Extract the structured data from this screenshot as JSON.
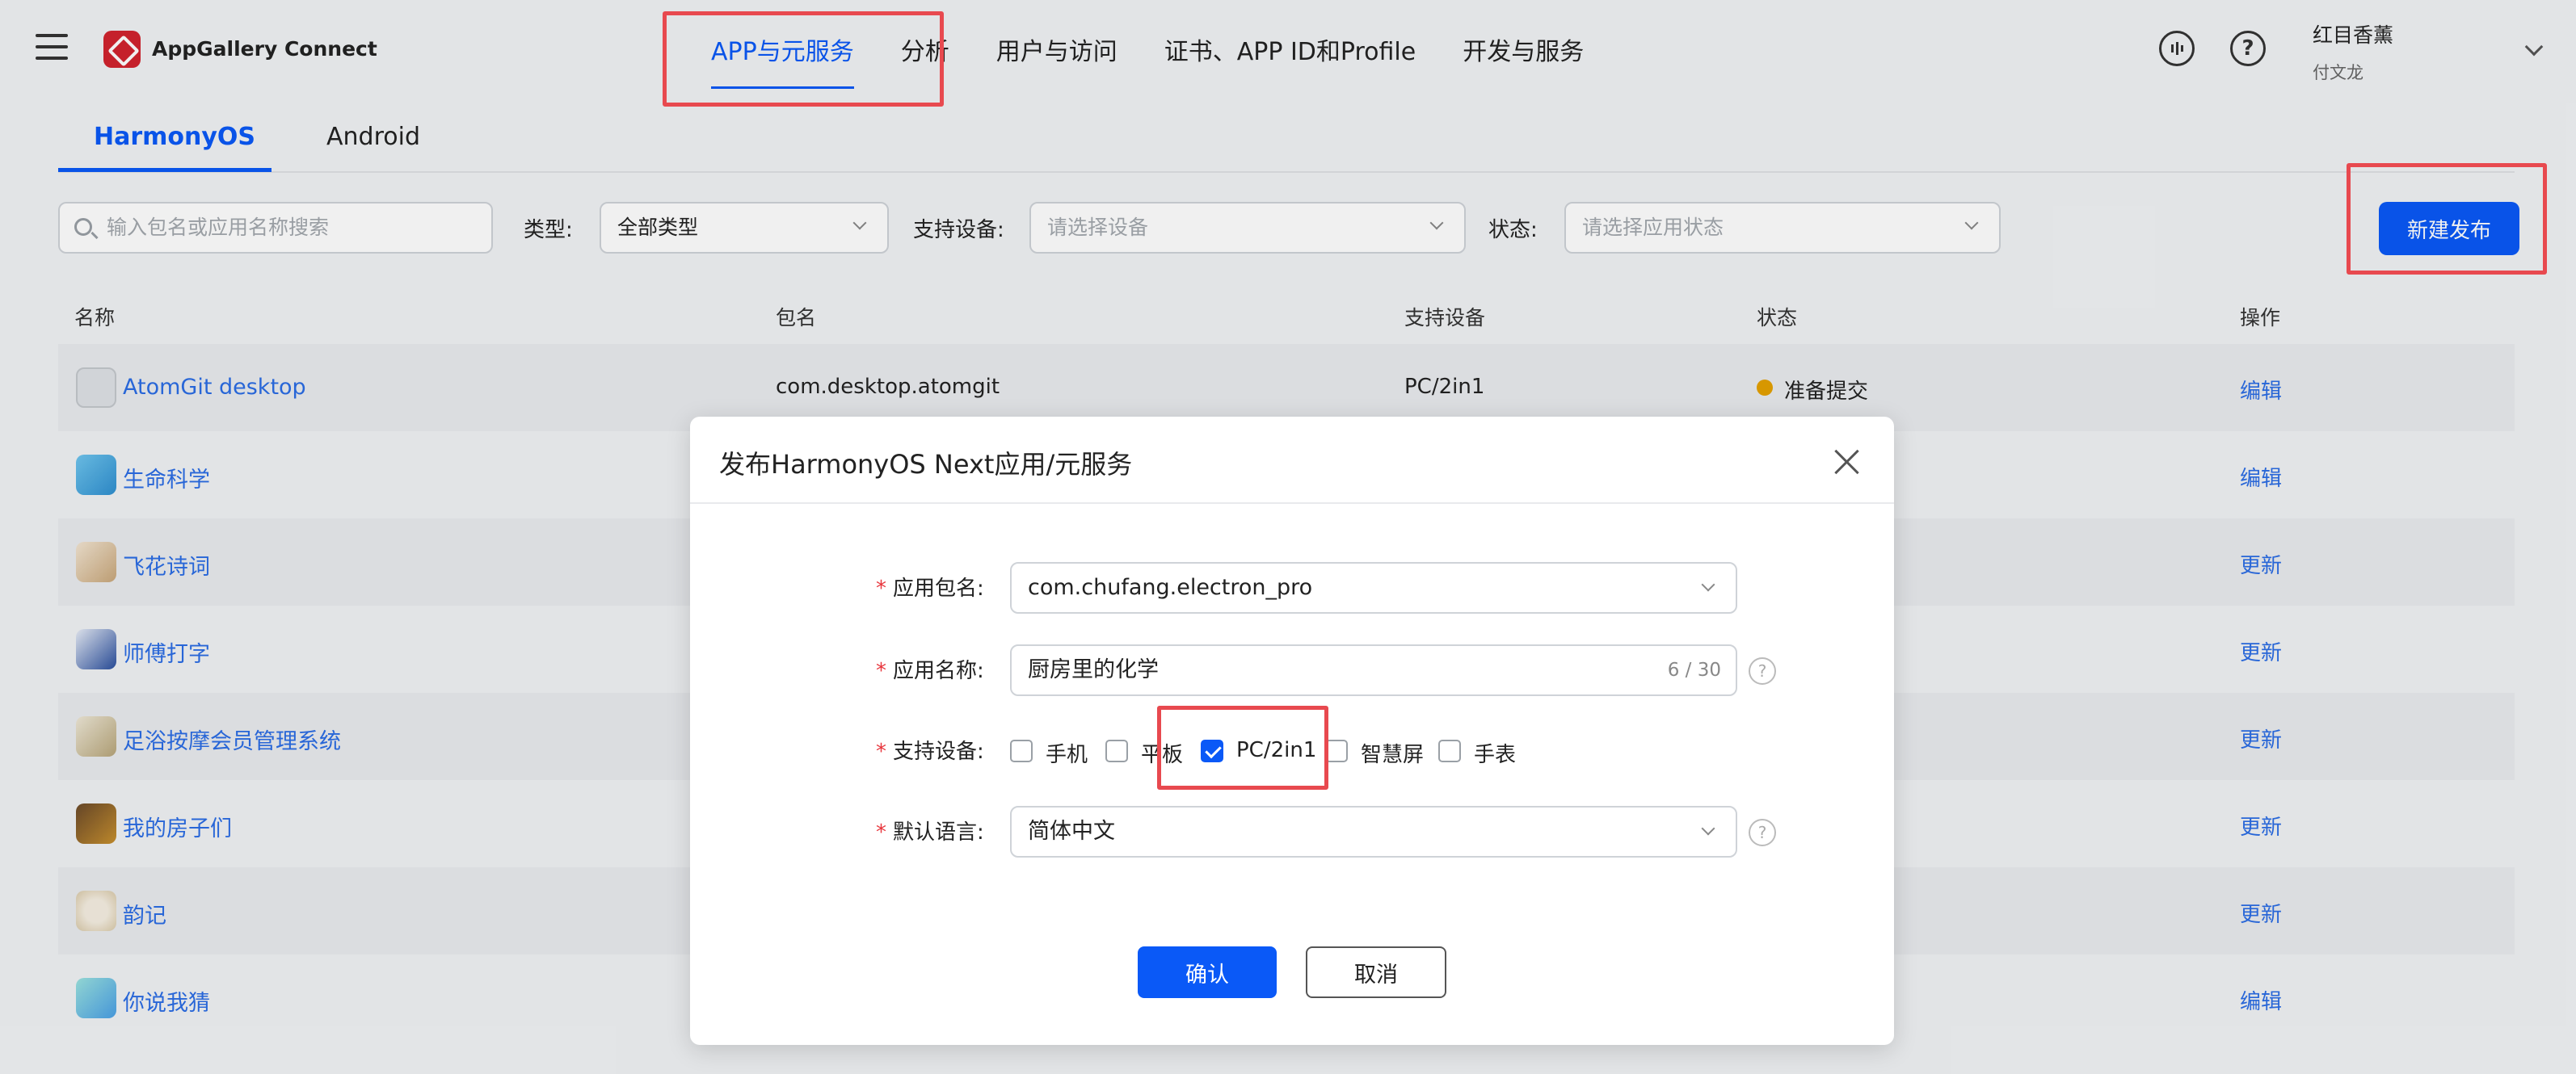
{
  "header": {
    "brand": "AppGallery Connect",
    "nav": [
      "APP与元服务",
      "分析",
      "用户与访问",
      "证书、APP ID和Profile",
      "开发与服务"
    ],
    "user_name": "红目香薰",
    "user_sub": "付文龙"
  },
  "tabs": [
    "HarmonyOS",
    "Android"
  ],
  "filters": {
    "search_placeholder": "输入包名或应用名称搜索",
    "type_label": "类型:",
    "type_value": "全部类型",
    "device_label": "支持设备:",
    "device_placeholder": "请选择设备",
    "status_label": "状态:",
    "status_placeholder": "请选择应用状态",
    "new_release": "新建发布"
  },
  "table": {
    "headers": [
      "名称",
      "包名",
      "支持设备",
      "状态",
      "操作"
    ],
    "rows": [
      {
        "name": "AtomGit desktop",
        "pkg": "com.desktop.atomgit",
        "device": "PC/2in1",
        "status": "准备提交",
        "op": "编辑"
      },
      {
        "name": "生命科学",
        "op": "编辑"
      },
      {
        "name": "飞花诗词",
        "op": "更新"
      },
      {
        "name": "师傅打字",
        "op": "更新"
      },
      {
        "name": "足浴按摩会员管理系统",
        "op": "更新"
      },
      {
        "name": "我的房子们",
        "op": "更新"
      },
      {
        "name": "韵记",
        "op": "更新"
      },
      {
        "name": "你说我猜",
        "op": "编辑"
      }
    ]
  },
  "modal": {
    "title": "发布HarmonyOS Next应用/元服务",
    "req": "*",
    "pkg_label": "应用包名:",
    "pkg_value": "com.chufang.electron_pro",
    "name_label": "应用名称:",
    "name_value": "厨房里的化学",
    "name_counter": "6 / 30",
    "device_label": "支持设备:",
    "devices": [
      {
        "label": "手机",
        "checked": false
      },
      {
        "label": "平板",
        "checked": false
      },
      {
        "label": "PC/2in1",
        "checked": true
      },
      {
        "label": "智慧屏",
        "checked": false
      },
      {
        "label": "手表",
        "checked": false
      }
    ],
    "lang_label": "默认语言:",
    "lang_value": "简体中文",
    "help": "?",
    "confirm": "确认",
    "cancel": "取消"
  },
  "colors": {
    "accent": "#0a59f7",
    "link": "#2b6de5",
    "status_pending": "#e5a100",
    "annotation": "#e8494f"
  }
}
